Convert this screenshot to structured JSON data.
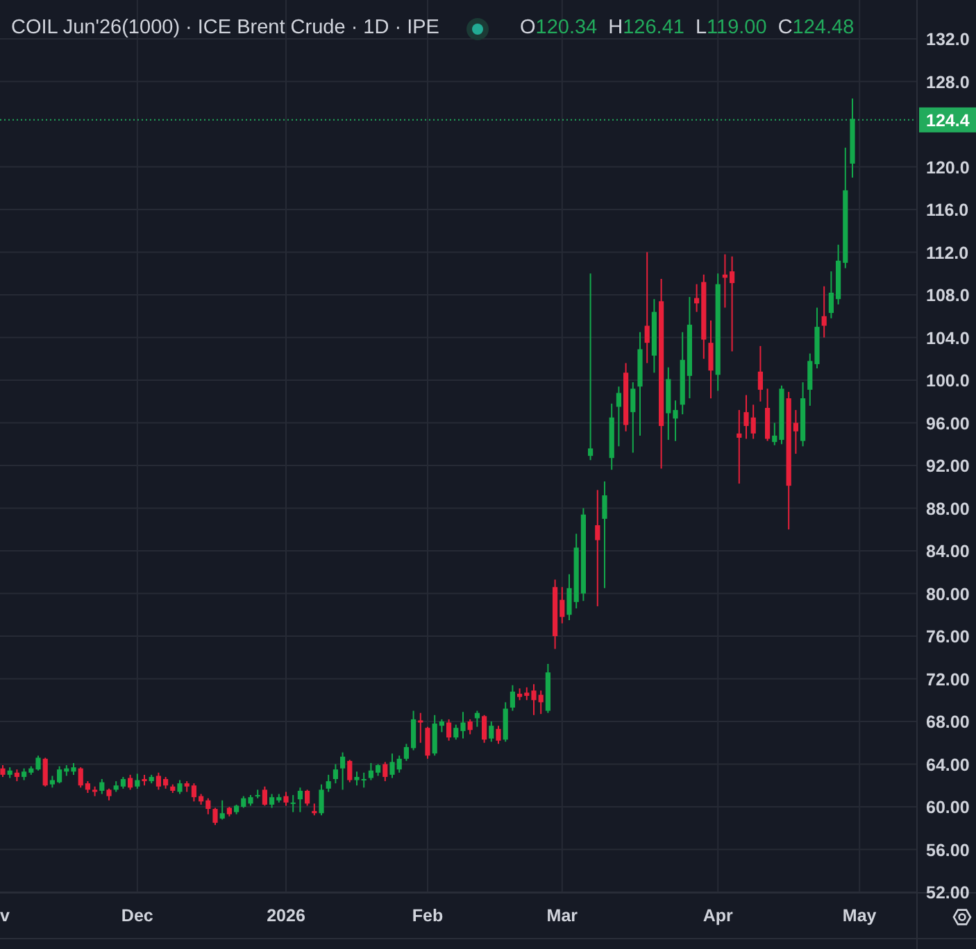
{
  "legend": {
    "title": "COIL Jun'26(1000) · ICE Brent Crude · 1D · IPE",
    "market_open": true,
    "ohlc": [
      {
        "label": "O",
        "value": "120.34"
      },
      {
        "label": "H",
        "value": "126.41"
      },
      {
        "label": "L",
        "value": "119.00"
      },
      {
        "label": "C",
        "value": "124.48"
      }
    ]
  },
  "chart": {
    "chart_data": {
      "type": "candlestick",
      "grid": true,
      "ylim": [
        52,
        132
      ],
      "yticks": [
        {
          "value": 132,
          "label": "132.0"
        },
        {
          "value": 128,
          "label": "128.0"
        },
        {
          "value": 120,
          "label": "120.0"
        },
        {
          "value": 116,
          "label": "116.0"
        },
        {
          "value": 112,
          "label": "112.0"
        },
        {
          "value": 108,
          "label": "108.0"
        },
        {
          "value": 104,
          "label": "104.0"
        },
        {
          "value": 100,
          "label": "100.0"
        },
        {
          "value": 96,
          "label": "96.00"
        },
        {
          "value": 92,
          "label": "92.00"
        },
        {
          "value": 88,
          "label": "88.00"
        },
        {
          "value": 84,
          "label": "84.00"
        },
        {
          "value": 80,
          "label": "80.00"
        },
        {
          "value": 76,
          "label": "76.00"
        },
        {
          "value": 72,
          "label": "72.00"
        },
        {
          "value": 68,
          "label": "68.00"
        },
        {
          "value": 64,
          "label": "64.00"
        },
        {
          "value": 60,
          "label": "60.00"
        },
        {
          "value": 56,
          "label": "56.00"
        },
        {
          "value": 52,
          "label": "52.00"
        }
      ],
      "categories": [
        "v",
        null,
        null,
        null,
        null,
        null,
        null,
        null,
        null,
        null,
        null,
        null,
        null,
        null,
        null,
        null,
        null,
        null,
        null,
        "Dec",
        null,
        null,
        null,
        null,
        null,
        null,
        null,
        null,
        null,
        null,
        null,
        null,
        null,
        null,
        null,
        null,
        null,
        null,
        null,
        null,
        "2026",
        null,
        null,
        null,
        null,
        null,
        null,
        null,
        null,
        null,
        null,
        null,
        null,
        null,
        null,
        null,
        null,
        null,
        null,
        null,
        "Feb",
        null,
        null,
        null,
        null,
        null,
        null,
        null,
        null,
        null,
        null,
        null,
        null,
        null,
        null,
        null,
        null,
        null,
        null,
        "Mar",
        null,
        null,
        null,
        null,
        null,
        null,
        null,
        null,
        null,
        null,
        null,
        null,
        null,
        null,
        null,
        null,
        null,
        null,
        null,
        null,
        null,
        "Apr",
        null,
        null,
        null,
        null,
        null,
        null,
        null,
        null,
        null,
        null,
        null,
        null,
        null,
        null,
        null,
        null,
        null,
        null,
        null,
        "May"
      ],
      "ref_lines": [
        {
          "axis": "y",
          "value": 124.4,
          "label": "124.4",
          "color": "#22ab5c"
        }
      ],
      "ohlc": [
        [
          63.6,
          63.9,
          62.8,
          63.0
        ],
        [
          63.0,
          63.7,
          62.7,
          63.4
        ],
        [
          63.2,
          63.5,
          62.4,
          62.8
        ],
        [
          62.8,
          63.6,
          62.5,
          63.3
        ],
        [
          63.2,
          63.8,
          63.0,
          63.6
        ],
        [
          63.5,
          64.8,
          63.4,
          64.6
        ],
        [
          64.5,
          64.6,
          61.9,
          62.0
        ],
        [
          62.1,
          62.9,
          61.8,
          62.5
        ],
        [
          62.3,
          63.8,
          62.2,
          63.5
        ],
        [
          63.3,
          63.9,
          62.9,
          63.6
        ],
        [
          63.3,
          64.1,
          63.0,
          63.7
        ],
        [
          63.6,
          63.7,
          61.8,
          62.0
        ],
        [
          62.2,
          62.4,
          61.3,
          61.6
        ],
        [
          61.6,
          61.9,
          61.0,
          61.4
        ],
        [
          61.5,
          62.6,
          61.2,
          62.3
        ],
        [
          61.6,
          61.7,
          60.6,
          61.0
        ],
        [
          61.6,
          62.4,
          61.4,
          62.0
        ],
        [
          61.9,
          62.8,
          61.7,
          62.6
        ],
        [
          62.7,
          63.0,
          61.6,
          61.8
        ],
        [
          61.9,
          63.1,
          61.7,
          62.5
        ],
        [
          62.6,
          63.0,
          62.0,
          62.4
        ],
        [
          62.4,
          63.0,
          62.2,
          62.8
        ],
        [
          62.9,
          63.2,
          61.6,
          61.9
        ],
        [
          62.6,
          62.8,
          61.7,
          62.0
        ],
        [
          61.9,
          62.1,
          61.3,
          61.5
        ],
        [
          61.4,
          62.5,
          61.2,
          62.2
        ],
        [
          62.2,
          62.4,
          61.4,
          61.9
        ],
        [
          62.0,
          62.2,
          60.5,
          60.9
        ],
        [
          61.0,
          61.2,
          60.2,
          60.5
        ],
        [
          60.6,
          60.8,
          59.3,
          59.8
        ],
        [
          59.8,
          59.9,
          58.3,
          58.5
        ],
        [
          58.9,
          60.6,
          58.8,
          59.4
        ],
        [
          59.9,
          60.0,
          59.1,
          59.3
        ],
        [
          59.5,
          60.2,
          59.3,
          60.1
        ],
        [
          60.0,
          61.0,
          59.9,
          60.8
        ],
        [
          60.3,
          61.1,
          60.1,
          60.9
        ],
        [
          61.0,
          61.6,
          60.8,
          61.1
        ],
        [
          61.6,
          61.9,
          60.1,
          60.2
        ],
        [
          60.2,
          61.2,
          59.9,
          60.9
        ],
        [
          60.6,
          61.2,
          60.4,
          60.9
        ],
        [
          61.0,
          61.4,
          60.1,
          60.4
        ],
        [
          60.3,
          61.1,
          59.5,
          60.4
        ],
        [
          60.7,
          61.8,
          59.5,
          61.5
        ],
        [
          61.5,
          61.6,
          60.1,
          60.3
        ],
        [
          59.6,
          60.3,
          59.2,
          59.4
        ],
        [
          59.4,
          62.1,
          59.2,
          61.6
        ],
        [
          61.7,
          63.0,
          61.4,
          62.4
        ],
        [
          62.6,
          64.0,
          62.2,
          63.5
        ],
        [
          63.6,
          65.1,
          61.6,
          64.7
        ],
        [
          64.3,
          64.4,
          62.3,
          62.5
        ],
        [
          62.5,
          63.3,
          62.0,
          62.8
        ],
        [
          62.5,
          63.2,
          61.8,
          62.6
        ],
        [
          62.7,
          64.1,
          62.5,
          63.4
        ],
        [
          63.2,
          64.0,
          62.9,
          63.9
        ],
        [
          64.0,
          64.2,
          62.4,
          62.8
        ],
        [
          63.0,
          65.0,
          62.7,
          64.2
        ],
        [
          63.5,
          64.8,
          63.2,
          64.5
        ],
        [
          64.5,
          65.9,
          64.3,
          65.6
        ],
        [
          65.5,
          69.0,
          65.3,
          68.2
        ],
        [
          68.1,
          68.8,
          66.0,
          67.9
        ],
        [
          67.4,
          67.5,
          64.5,
          64.8
        ],
        [
          65.0,
          68.6,
          64.8,
          67.8
        ],
        [
          67.6,
          68.2,
          67.0,
          68.0
        ],
        [
          67.9,
          68.2,
          66.2,
          66.5
        ],
        [
          66.5,
          67.7,
          66.3,
          67.4
        ],
        [
          67.1,
          68.9,
          66.4,
          67.9
        ],
        [
          68.0,
          68.2,
          66.8,
          67.2
        ],
        [
          68.3,
          69.0,
          67.5,
          68.8
        ],
        [
          68.5,
          68.6,
          66.0,
          66.3
        ],
        [
          66.4,
          68.0,
          66.1,
          67.6
        ],
        [
          67.3,
          67.6,
          65.9,
          66.2
        ],
        [
          66.3,
          69.8,
          66.1,
          69.2
        ],
        [
          69.3,
          71.4,
          69.0,
          70.8
        ],
        [
          70.6,
          71.1,
          70.0,
          70.3
        ],
        [
          70.7,
          71.2,
          70.0,
          70.4
        ],
        [
          70.9,
          71.5,
          68.6,
          70.0
        ],
        [
          70.5,
          70.9,
          68.7,
          69.8
        ],
        [
          69.0,
          73.4,
          68.8,
          72.6
        ],
        [
          80.6,
          81.3,
          74.8,
          76.0
        ],
        [
          79.4,
          80.6,
          77.2,
          77.8
        ],
        [
          78.0,
          81.8,
          77.5,
          80.5
        ],
        [
          79.2,
          85.6,
          78.6,
          84.3
        ],
        [
          80.0,
          88.0,
          79.3,
          87.4
        ],
        [
          92.9,
          110.0,
          92.5,
          93.6
        ],
        [
          86.4,
          89.7,
          78.8,
          85.0
        ],
        [
          87.0,
          90.5,
          80.5,
          89.2
        ],
        [
          92.7,
          97.8,
          91.6,
          96.5
        ],
        [
          97.5,
          99.4,
          93.8,
          98.8
        ],
        [
          100.7,
          101.6,
          95.2,
          95.8
        ],
        [
          97.0,
          99.8,
          93.2,
          99.2
        ],
        [
          99.4,
          104.5,
          94.8,
          102.9
        ],
        [
          105.1,
          112.0,
          101.6,
          103.5
        ],
        [
          102.3,
          107.6,
          100.7,
          106.4
        ],
        [
          107.4,
          109.5,
          91.7,
          95.7
        ],
        [
          96.9,
          101.2,
          94.4,
          100.1
        ],
        [
          96.4,
          98.1,
          94.3,
          97.2
        ],
        [
          97.7,
          104.5,
          96.8,
          101.9
        ],
        [
          100.4,
          107.8,
          98.3,
          105.2
        ],
        [
          107.7,
          109.0,
          106.4,
          107.2
        ],
        [
          109.2,
          109.9,
          102.0,
          103.8
        ],
        [
          103.5,
          105.6,
          98.3,
          100.9
        ],
        [
          100.5,
          110.0,
          99.0,
          109.0
        ],
        [
          109.9,
          111.8,
          106.8,
          109.6
        ],
        [
          110.2,
          111.6,
          102.7,
          109.1
        ],
        [
          95.0,
          97.2,
          90.3,
          94.6
        ],
        [
          97.0,
          98.6,
          94.5,
          95.7
        ],
        [
          96.5,
          97.7,
          94.5,
          95.0
        ],
        [
          100.8,
          103.2,
          98.0,
          99.1
        ],
        [
          97.4,
          99.2,
          94.3,
          94.5
        ],
        [
          94.2,
          96.0,
          93.9,
          94.8
        ],
        [
          94.4,
          99.5,
          94.0,
          99.2
        ],
        [
          98.3,
          98.9,
          86.0,
          90.1
        ],
        [
          96.0,
          97.2,
          93.1,
          95.2
        ],
        [
          94.3,
          99.8,
          93.8,
          98.3
        ],
        [
          99.1,
          102.5,
          97.6,
          101.8
        ],
        [
          101.5,
          106.8,
          101.1,
          105.0
        ],
        [
          106.0,
          108.8,
          104.0,
          105.1
        ],
        [
          106.3,
          110.2,
          105.8,
          108.2
        ],
        [
          107.6,
          112.7,
          107.1,
          111.2
        ],
        [
          111.0,
          121.8,
          110.5,
          117.8
        ],
        [
          120.3,
          126.4,
          119.0,
          124.5
        ],
        null
      ]
    }
  },
  "time_axis": {
    "settings": true
  }
}
